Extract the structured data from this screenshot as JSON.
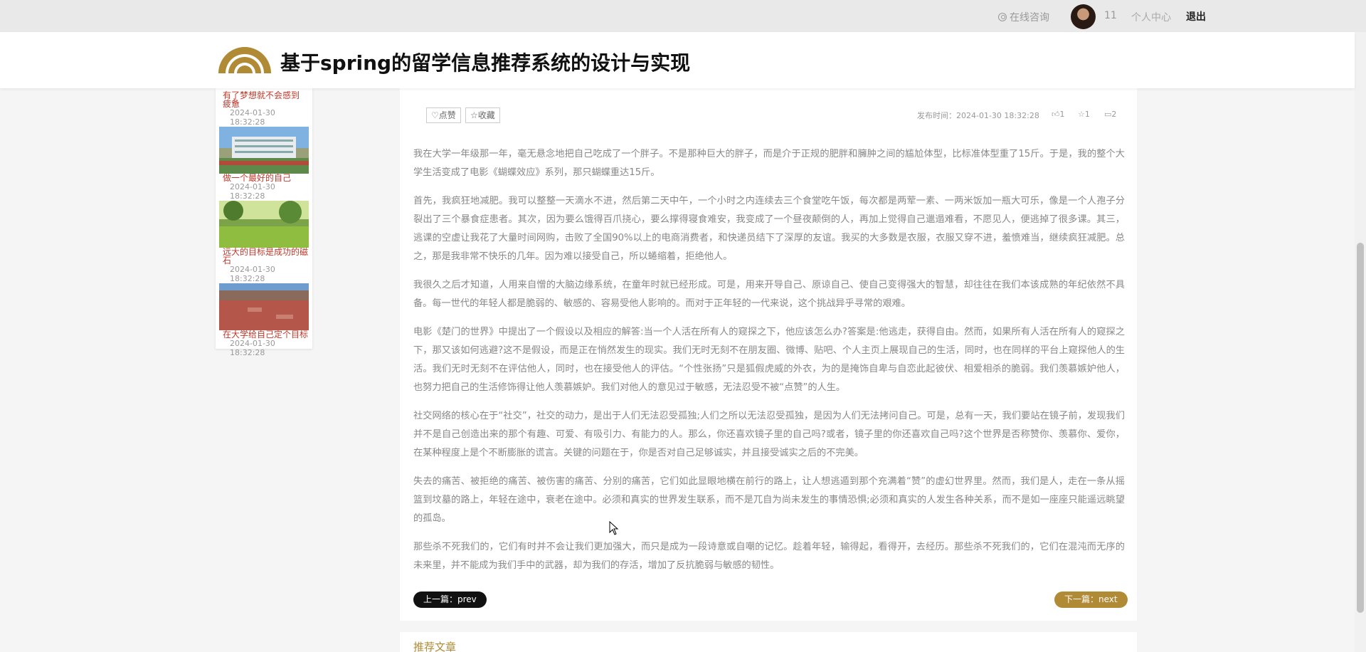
{
  "topbar": {
    "consult": "在线咨询",
    "username": "11",
    "personal_center": "个人中心",
    "logout": "退出"
  },
  "header": {
    "title": "基于spring的留学信息推荐系统的设计与实现",
    "accent_color": "#b08a35"
  },
  "sidebar": {
    "items": [
      {
        "title": "有了梦想就不会感到疲惫",
        "date": "2024-01-30 18:32:28"
      },
      {
        "title": "做一个最好的自己",
        "date": "2024-01-30 18:32:28"
      },
      {
        "title": "远大的目标是成功的磁石",
        "date": "2024-01-30 18:32:28"
      },
      {
        "title": "在大学给自己定个目标",
        "date": "2024-01-30 18:32:28"
      }
    ]
  },
  "article": {
    "like_label": "♡点赞",
    "fav_label": "☆收藏",
    "publish_time": "发布时间：2024-01-30 18:32:28",
    "likes": "1",
    "favorites": "1",
    "comments": "2",
    "paragraphs": [
      "我在大学一年级那一年，毫无悬念地把自己吃成了一个胖子。不是那种巨大的胖子，而是介于正规的肥胖和臃肿之间的尴尬体型，比标准体型重了15斤。于是，我的整个大学生活变成了电影《蝴蝶效应》系列，那只蝴蝶重达15斤。",
      "首先，我疯狂地减肥。我可以整整一天滴水不进，然后第二天中午，一个小时之内连续去三个食堂吃午饭，每次都是两荤一素、一两米饭加一瓶大可乐，像是一个人孢子分裂出了三个暴食症患者。其次，因为要么饿得百爪挠心，要么撑得寝食难安，我变成了一个昼夜颠倒的人，再加上觉得自己邋遢难看，不愿见人，便逃掉了很多课。其三，逃课的空虚让我花了大量时间网购，击败了全国90%以上的电商消费者，和快递员结下了深厚的友谊。我买的大多数是衣服，衣服又穿不进，羞愤难当，继续疯狂减肥。总之，那是我非常不快乐的几年。因为难以接受自己，所以蜷缩着，拒绝他人。",
      "我很久之后才知道，人用来自憎的大脑边缘系统，在童年时就已经形成。可是，用来开导自己、原谅自己、使自己变得强大的智慧，却往往在我们本该成熟的年纪依然不具备。每一世代的年轻人都是脆弱的、敏感的、容易受他人影响的。而对于正年轻的一代来说，这个挑战异乎寻常的艰难。",
      "电影《楚门的世界》中提出了一个假设以及相应的解答:当一个人活在所有人的窥探之下，他应该怎么办?答案是:他逃走，获得自由。然而，如果所有人活在所有人的窥探之下，那又该如何逃避?这不是假设，而是正在悄然发生的现实。我们无时无刻不在朋友圈、微博、贴吧、个人主页上展现自己的生活，同时，也在同样的平台上窥探他人的生活。我们无时无刻不在评估他人，同时，也在接受他人的评估。“个性张扬”只是狐假虎威的外衣，为的是掩饰自卑与自恋此起彼伏、相爱相杀的脆弱。我们羡慕嫉妒他人，也努力把自己的生活修饰得让他人羡慕嫉妒。我们对他人的意见过于敏感，无法忍受不被“点赞”的人生。",
      "社交网络的核心在于“社交”，社交的动力，是出于人们无法忍受孤独;人们之所以无法忍受孤独，是因为人们无法拷问自己。可是，总有一天，我们要站在镜子前，发现我们并不是自己创造出来的那个有趣、可爱、有吸引力、有能力的人。那么，你还喜欢镜子里的自己吗?或者，镜子里的你还喜欢自己吗?这个世界是否称赞你、羡慕你、爱你，在某种程度上是个不断膨胀的谎言。关键的问题在于，你是否对自己足够诚实，并且接受诚实之后的不完美。",
      "失去的痛苦、被拒绝的痛苦、被伤害的痛苦、分别的痛苦，它们如此显眼地横在前行的路上，让人想逃遁到那个充满着“赞”的虚幻世界里。然而，我们是人，走在一条从摇篮到坟墓的路上，年轻在途中，衰老在途中。必须和真实的世界发生联系，而不是兀自为尚未发生的事情恐惧;必须和真实的人发生各种关系，而不是如一座座只能遥远眺望的孤岛。",
      "那些杀不死我们的，它们有时并不会让我们更加强大，而只是成为一段诗意或自嘲的记忆。趁着年轻，输得起，看得开，去经历。那些杀不死我们的，它们在混沌而无序的未来里，并不能成为我们手中的武器，却为我们的存活，增加了反抗脆弱与敏感的韧性。"
    ],
    "prev_label": "上一篇：prev",
    "next_label": "下一篇：next"
  },
  "recommend": {
    "label": "推荐文章"
  }
}
